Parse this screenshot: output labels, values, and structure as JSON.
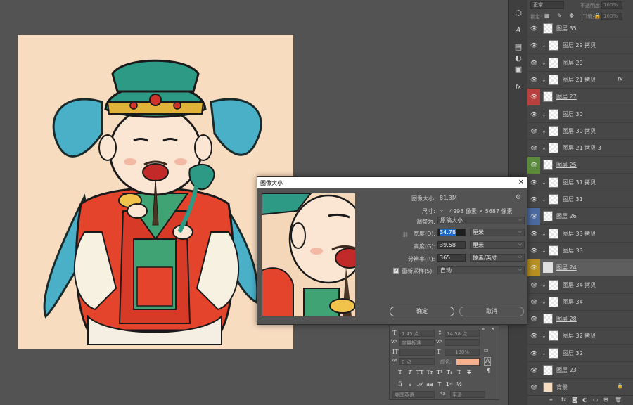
{
  "layers_panel": {
    "blend_mode": "正常",
    "opacity_label": "不透明度:",
    "opacity_value": "100%",
    "lock_label": "锁定:",
    "fill_label": "填充:",
    "fill_value": "100%",
    "layers": [
      {
        "name": "图层 35",
        "clip": false,
        "color": "",
        "underline": false,
        "fx": false,
        "lock": false
      },
      {
        "name": "图层 29 拷贝",
        "clip": true,
        "color": "",
        "underline": false,
        "fx": false,
        "lock": false
      },
      {
        "name": "图层 29",
        "clip": true,
        "color": "",
        "underline": false,
        "fx": false,
        "lock": false
      },
      {
        "name": "图层 21 拷贝",
        "clip": true,
        "color": "",
        "underline": false,
        "fx": true,
        "lock": false
      },
      {
        "name": "图层 27",
        "clip": false,
        "color": "#b8413f",
        "underline": true,
        "fx": false,
        "lock": false
      },
      {
        "name": "图层 30",
        "clip": true,
        "color": "",
        "underline": false,
        "fx": false,
        "lock": false
      },
      {
        "name": "图层 30 拷贝",
        "clip": true,
        "color": "",
        "underline": false,
        "fx": false,
        "lock": false
      },
      {
        "name": "图层 21 拷贝 3",
        "clip": true,
        "color": "",
        "underline": false,
        "fx": false,
        "lock": false
      },
      {
        "name": "图层 25",
        "clip": false,
        "color": "#5a8a3c",
        "underline": true,
        "fx": false,
        "lock": false
      },
      {
        "name": "图层 31 拷贝",
        "clip": true,
        "color": "",
        "underline": false,
        "fx": false,
        "lock": false
      },
      {
        "name": "图层 31",
        "clip": true,
        "color": "",
        "underline": false,
        "fx": false,
        "lock": false
      },
      {
        "name": "图层 26",
        "clip": false,
        "color": "#4a6aa0",
        "underline": true,
        "fx": false,
        "lock": false
      },
      {
        "name": "图层 33 拷贝",
        "clip": true,
        "color": "",
        "underline": false,
        "fx": false,
        "lock": false
      },
      {
        "name": "图层 33",
        "clip": true,
        "color": "",
        "underline": false,
        "fx": false,
        "lock": false
      },
      {
        "name": "图层 24",
        "clip": false,
        "color": "#b89020",
        "underline": true,
        "fx": false,
        "lock": false,
        "selected": true
      },
      {
        "name": "图层 34 拷贝",
        "clip": true,
        "color": "",
        "underline": false,
        "fx": false,
        "lock": false
      },
      {
        "name": "图层 34",
        "clip": true,
        "color": "",
        "underline": false,
        "fx": false,
        "lock": false
      },
      {
        "name": "图层 28",
        "clip": false,
        "color": "",
        "underline": true,
        "fx": false,
        "lock": false
      },
      {
        "name": "图层 32 拷贝",
        "clip": true,
        "color": "",
        "underline": false,
        "fx": false,
        "lock": false
      },
      {
        "name": "图层 32",
        "clip": true,
        "color": "",
        "underline": false,
        "fx": false,
        "lock": false
      },
      {
        "name": "图层 23",
        "clip": false,
        "color": "",
        "underline": true,
        "fx": false,
        "lock": false
      },
      {
        "name": "背景",
        "clip": false,
        "color": "",
        "underline": false,
        "fx": false,
        "lock": true,
        "bg": true
      }
    ]
  },
  "dialog": {
    "title": "图像大小",
    "image_size_label": "图像大小:",
    "image_size_value": "81.3M",
    "dimensions_label": "尺寸:",
    "dimensions_value": "4998 像素  ×  5687 像素",
    "fit_label": "调整为:",
    "fit_value": "原稿大小",
    "width_label": "宽度(D):",
    "width_value": "34.78",
    "width_unit": "厘米",
    "height_label": "高度(G):",
    "height_value": "39.58",
    "height_unit": "厘米",
    "resolution_label": "分辨率(R):",
    "resolution_value": "365",
    "resolution_unit": "像素/英寸",
    "resample_label": "重新采样(S):",
    "resample_value": "自动",
    "ok_label": "确定",
    "cancel_label": "取消"
  },
  "char_panel": {
    "size_value": "1.45 点",
    "leading_value": "14.58 点",
    "kerning_value": "度量标准",
    "scale_value": "100%",
    "baseline_value": "0 点",
    "color_label": "颜色:",
    "color_value": "#f6b08e",
    "language": "美国英语",
    "aa_value": "平滑"
  },
  "colors": {
    "accent": "#1b6ac9",
    "canvas_bg": "#f8dcc0",
    "app_bg": "#535353",
    "panel_bg": "#474747"
  }
}
